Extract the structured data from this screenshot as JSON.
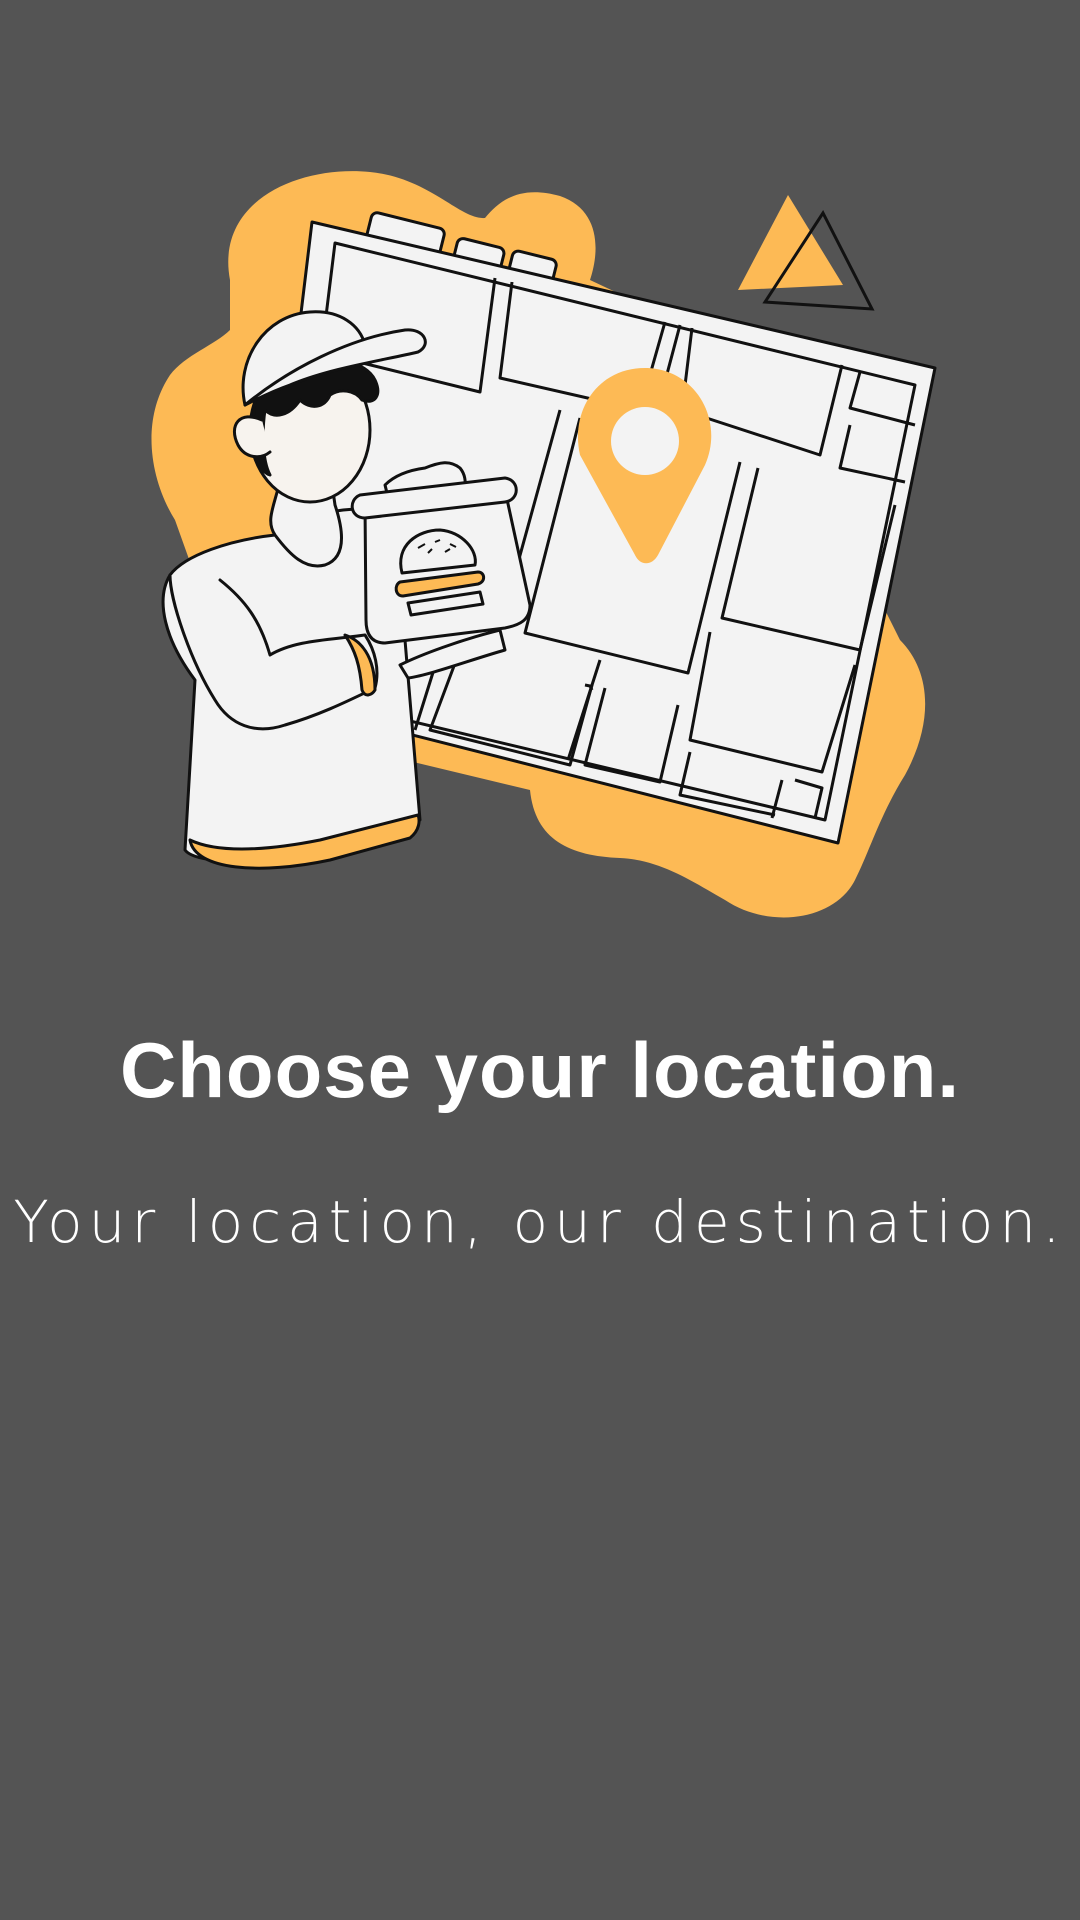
{
  "screen": {
    "title": "Choose your location.",
    "subtitle": "Your location, our destination."
  },
  "illustration": {
    "subject": "delivery-person-with-map",
    "icons": [
      "map-pin-icon",
      "burger-icon",
      "triangle-icon"
    ]
  },
  "colors": {
    "background": "#545454",
    "accent": "#FDBA55",
    "text": "#FFFFFF",
    "outline": "#111111",
    "paper": "#F3F3F3"
  }
}
